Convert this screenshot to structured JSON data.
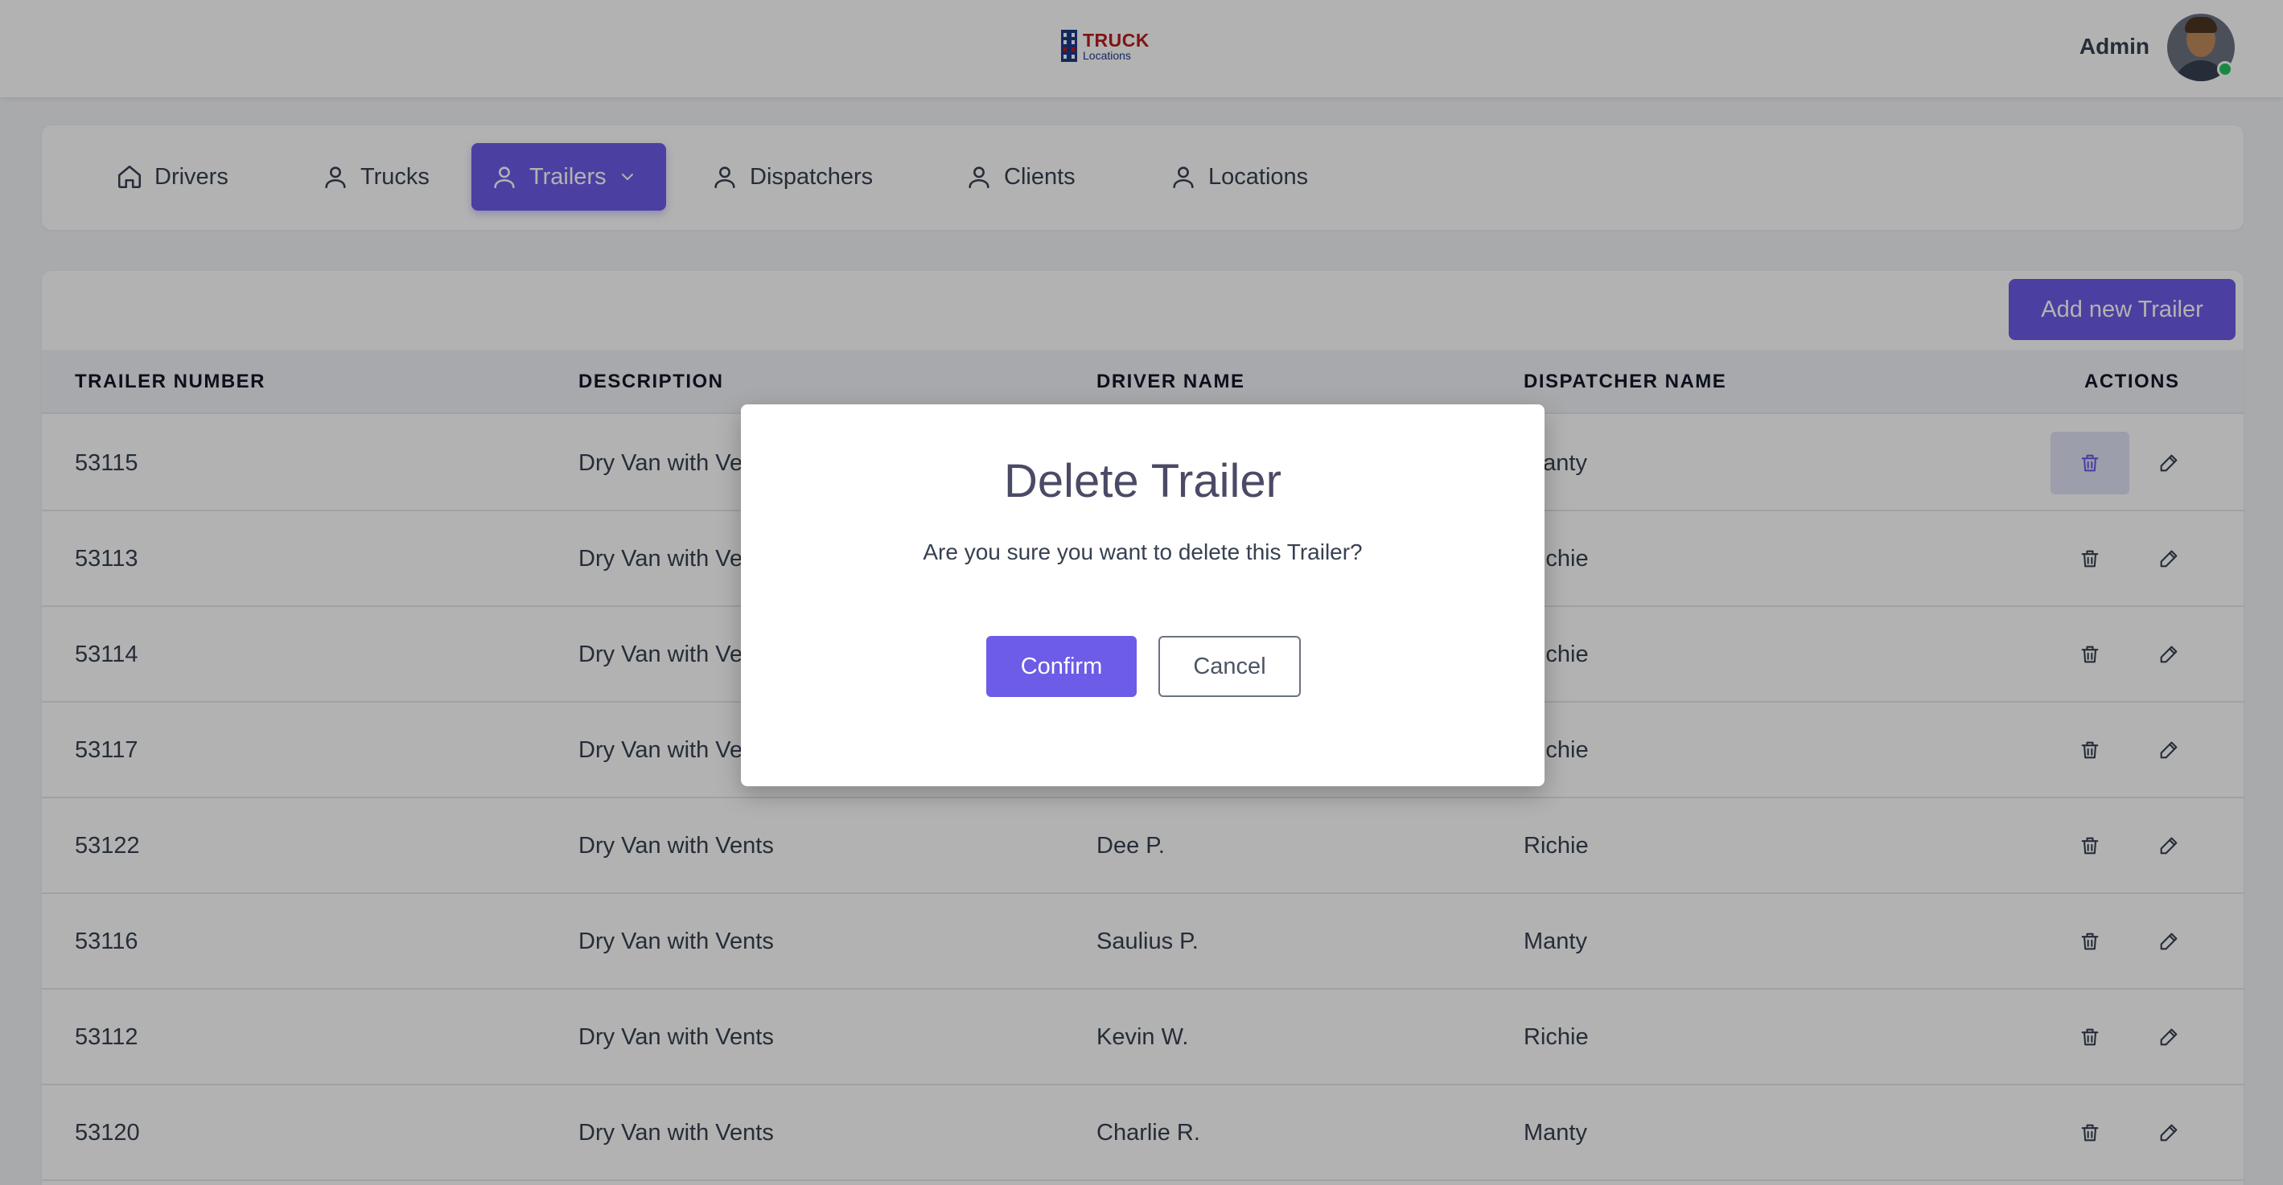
{
  "header": {
    "logo_main": "TRUCK",
    "logo_sub": "Locations",
    "user_name": "Admin"
  },
  "tabs": [
    {
      "label": "Drivers",
      "icon": "home-icon"
    },
    {
      "label": "Trucks",
      "icon": "user-icon"
    },
    {
      "label": "Trailers",
      "icon": "user-icon",
      "active": true
    },
    {
      "label": "Dispatchers",
      "icon": "user-icon"
    },
    {
      "label": "Clients",
      "icon": "user-icon"
    },
    {
      "label": "Locations",
      "icon": "user-icon"
    }
  ],
  "table": {
    "add_button": "Add new Trailer",
    "columns": [
      "TRAILER NUMBER",
      "DESCRIPTION",
      "DRIVER NAME",
      "DISPATCHER NAME",
      "ACTIONS"
    ],
    "rows": [
      {
        "number": "53115",
        "description": "Dry Van with Vents",
        "driver": "",
        "dispatcher": "Manty"
      },
      {
        "number": "53113",
        "description": "Dry Van with Vents",
        "driver": "",
        "dispatcher": "Richie"
      },
      {
        "number": "53114",
        "description": "Dry Van with Vents",
        "driver": "",
        "dispatcher": "Richie"
      },
      {
        "number": "53117",
        "description": "Dry Van with Vents",
        "driver": "",
        "dispatcher": "Richie"
      },
      {
        "number": "53122",
        "description": "Dry Van with Vents",
        "driver": "Dee P.",
        "dispatcher": "Richie"
      },
      {
        "number": "53116",
        "description": "Dry Van with Vents",
        "driver": "Saulius P.",
        "dispatcher": "Manty"
      },
      {
        "number": "53112",
        "description": "Dry Van with Vents",
        "driver": "Kevin W.",
        "dispatcher": "Richie"
      },
      {
        "number": "53120",
        "description": "Dry Van with Vents",
        "driver": "Charlie R.",
        "dispatcher": "Manty"
      }
    ]
  },
  "modal": {
    "title": "Delete Trailer",
    "message": "Are you sure you want to delete this Trailer?",
    "confirm": "Confirm",
    "cancel": "Cancel"
  },
  "colors": {
    "accent": "#6c5ce7",
    "background": "#f3f4f6",
    "online": "#22c55e"
  }
}
